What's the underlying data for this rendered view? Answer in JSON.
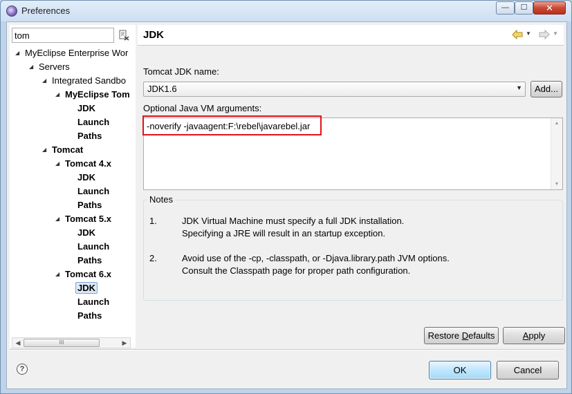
{
  "window": {
    "title": "Preferences",
    "controls": {
      "minimize": "—",
      "maximize": "☐",
      "close": "✕"
    }
  },
  "filter": {
    "value": "tom"
  },
  "tree": {
    "items": [
      {
        "label": "MyEclipse Enterprise Wor",
        "twisty": "◢"
      },
      {
        "label": "Servers",
        "twisty": "◢"
      },
      {
        "label": "Integrated Sandbo",
        "twisty": "◢"
      },
      {
        "label": "MyEclipse Tom",
        "twisty": "◢"
      },
      {
        "label": "JDK"
      },
      {
        "label": "Launch"
      },
      {
        "label": "Paths"
      },
      {
        "label": "Tomcat",
        "twisty": "◢"
      },
      {
        "label": "Tomcat  4.x",
        "twisty": "◢"
      },
      {
        "label": "JDK"
      },
      {
        "label": "Launch"
      },
      {
        "label": "Paths"
      },
      {
        "label": "Tomcat  5.x",
        "twisty": "◢"
      },
      {
        "label": "JDK"
      },
      {
        "label": "Launch"
      },
      {
        "label": "Paths"
      },
      {
        "label": "Tomcat  6.x",
        "twisty": "◢"
      },
      {
        "label": "JDK",
        "selected": true
      },
      {
        "label": "Launch"
      },
      {
        "label": "Paths"
      }
    ],
    "scroll_grip": "III"
  },
  "page": {
    "title": "JDK",
    "jdk_name_label": "Tomcat JDK name:",
    "jdk_name_value": "JDK1.6",
    "add_button": "Add...",
    "vm_args_label": "Optional Java VM arguments:",
    "vm_args_value": "-noverify -javaagent:F:\\rebel\\javarebel.jar",
    "notes": {
      "title": "Notes",
      "items": [
        {
          "num": "1.",
          "line1": "JDK Virtual Machine must specify a full JDK installation.",
          "line2": "Specifying a JRE will result in an startup exception."
        },
        {
          "num": "2.",
          "line1": "Avoid use of the -cp, -classpath, or -Djava.library.path JVM options.",
          "line2": "Consult the Classpath page for proper path configuration."
        }
      ]
    },
    "restore_defaults_pre": "Restore ",
    "restore_defaults_ul": "D",
    "restore_defaults_post": "efaults",
    "apply_ul": "A",
    "apply_post": "pply"
  },
  "footer": {
    "help": "?",
    "ok": "OK",
    "cancel": "Cancel"
  },
  "colors": {
    "highlight_box": "#e0111a",
    "selection": "#dbe8f8",
    "ok_button": "#bee6fd"
  },
  "icons": [
    "app-icon",
    "clear-filter-icon",
    "back-arrow-icon",
    "forward-arrow-icon",
    "help-icon",
    "dropdown-arrow-icon"
  ]
}
